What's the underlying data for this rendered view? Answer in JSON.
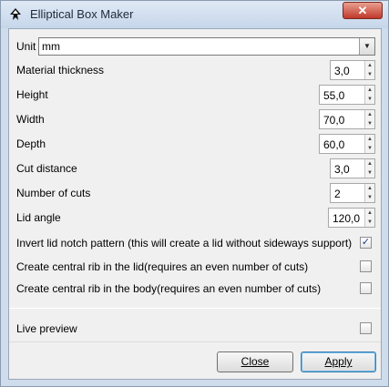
{
  "window": {
    "title": "Elliptical Box Maker",
    "close_glyph": "✕",
    "app_icon": "inkscape-icon"
  },
  "unit": {
    "label": "Unit",
    "value": "mm",
    "dropdown_icon": "chevron-down-icon"
  },
  "fields": [
    {
      "label": "Material thickness",
      "value": "3,0"
    },
    {
      "label": "Height",
      "value": "55,0"
    },
    {
      "label": "Width",
      "value": "70,0"
    },
    {
      "label": "Depth",
      "value": "60,0"
    },
    {
      "label": "Cut distance",
      "value": "3,0"
    },
    {
      "label": "Number of cuts",
      "value": "2"
    },
    {
      "label": "Lid angle",
      "value": "120,0"
    }
  ],
  "checkboxes": [
    {
      "label": "Invert lid notch pattern (this will create a lid without sideways support)",
      "checked": true
    },
    {
      "label": "Create central rib in the lid(requires an even number of cuts)",
      "checked": false
    },
    {
      "label": "Create central rib in the body(requires an even number of cuts)",
      "checked": false
    }
  ],
  "live_preview": {
    "label": "Live preview",
    "checked": false
  },
  "buttons": {
    "close_label": "Close",
    "apply_label": "Apply"
  },
  "colors": {
    "accent": "#3c7fb1",
    "close_red": "#c0392b"
  }
}
